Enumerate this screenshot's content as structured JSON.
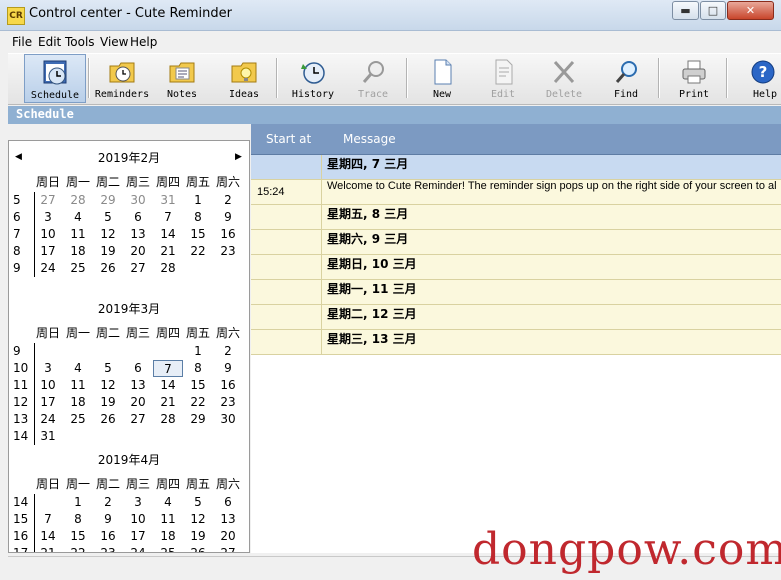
{
  "window": {
    "icon_text": "CR",
    "title": "Control center - Cute Reminder",
    "min_glyph": "▬",
    "max_glyph": "□",
    "close_glyph": "✕"
  },
  "menu": [
    "File",
    "Edit",
    "Tools",
    "View",
    "Help"
  ],
  "toolbar": [
    {
      "label": "Schedule",
      "icon": "schedule-clock-icon",
      "enabled": true,
      "active": true
    },
    {
      "label": "Reminders",
      "icon": "reminders-folder-clock-icon",
      "enabled": true
    },
    {
      "label": "Notes",
      "icon": "notes-folder-icon",
      "enabled": true
    },
    {
      "label": "Ideas",
      "icon": "ideas-folder-icon",
      "enabled": true
    },
    {
      "label": "History",
      "icon": "history-icon",
      "enabled": true
    },
    {
      "label": "Trace",
      "icon": "trace-magnifier-icon",
      "enabled": false
    },
    {
      "label": "New",
      "icon": "new-document-icon",
      "enabled": true
    },
    {
      "label": "Edit",
      "icon": "edit-document-icon",
      "enabled": false
    },
    {
      "label": "Delete",
      "icon": "delete-x-icon",
      "enabled": false
    },
    {
      "label": "Find",
      "icon": "find-magnifier-icon",
      "enabled": true
    },
    {
      "label": "Print",
      "icon": "printer-icon",
      "enabled": true
    },
    {
      "label": "Help",
      "icon": "help-icon",
      "enabled": true
    }
  ],
  "section_title": "Schedule",
  "calendar": {
    "weekday_headers": [
      "周日",
      "周一",
      "周二",
      "周三",
      "周四",
      "周五",
      "周六"
    ],
    "months": [
      {
        "title": "2019年2月",
        "weeks": [
          {
            "num": "5",
            "days": [
              "27",
              "28",
              "29",
              "30",
              "31",
              "1",
              "2"
            ],
            "dim_until": 5
          },
          {
            "num": "6",
            "days": [
              "3",
              "4",
              "5",
              "6",
              "7",
              "8",
              "9"
            ]
          },
          {
            "num": "7",
            "days": [
              "10",
              "11",
              "12",
              "13",
              "14",
              "15",
              "16"
            ]
          },
          {
            "num": "8",
            "days": [
              "17",
              "18",
              "19",
              "20",
              "21",
              "22",
              "23"
            ]
          },
          {
            "num": "9",
            "days": [
              "24",
              "25",
              "26",
              "27",
              "28",
              "",
              ""
            ]
          }
        ]
      },
      {
        "title": "2019年3月",
        "weeks": [
          {
            "num": "9",
            "days": [
              "",
              "",
              "",
              "",
              "",
              "1",
              "2"
            ]
          },
          {
            "num": "10",
            "days": [
              "3",
              "4",
              "5",
              "6",
              "7",
              "8",
              "9"
            ],
            "today_index": 4
          },
          {
            "num": "11",
            "days": [
              "10",
              "11",
              "12",
              "13",
              "14",
              "15",
              "16"
            ]
          },
          {
            "num": "12",
            "days": [
              "17",
              "18",
              "19",
              "20",
              "21",
              "22",
              "23"
            ]
          },
          {
            "num": "13",
            "days": [
              "24",
              "25",
              "26",
              "27",
              "28",
              "29",
              "30"
            ]
          },
          {
            "num": "14",
            "days": [
              "31",
              "",
              "",
              "",
              "",
              "",
              ""
            ]
          }
        ]
      },
      {
        "title": "2019年4月",
        "weeks": [
          {
            "num": "14",
            "days": [
              "",
              "1",
              "2",
              "3",
              "4",
              "5",
              "6"
            ]
          },
          {
            "num": "15",
            "days": [
              "7",
              "8",
              "9",
              "10",
              "11",
              "12",
              "13"
            ]
          },
          {
            "num": "16",
            "days": [
              "14",
              "15",
              "16",
              "17",
              "18",
              "19",
              "20"
            ]
          },
          {
            "num": "17",
            "days": [
              "21",
              "22",
              "23",
              "24",
              "25",
              "26",
              "27"
            ]
          }
        ]
      }
    ]
  },
  "schedule": {
    "col_start": "Start at",
    "col_message": "Message",
    "rows": [
      {
        "time": "",
        "text": "星期四, 7 三月",
        "kind": "head",
        "selected": true
      },
      {
        "time": "15:24",
        "text": "Welcome to Cute Reminder! The reminder sign pops up on the right side of your screen to alert you",
        "kind": "msg"
      },
      {
        "time": "",
        "text": "星期五, 8 三月",
        "kind": "head"
      },
      {
        "time": "",
        "text": "星期六, 9 三月",
        "kind": "head"
      },
      {
        "time": "",
        "text": "星期日, 10 三月",
        "kind": "head"
      },
      {
        "time": "",
        "text": "星期一, 11 三月",
        "kind": "head"
      },
      {
        "time": "",
        "text": "星期二, 12 三月",
        "kind": "head"
      },
      {
        "time": "",
        "text": "星期三, 13 三月",
        "kind": "head"
      }
    ]
  },
  "watermark": "dongpow.com"
}
